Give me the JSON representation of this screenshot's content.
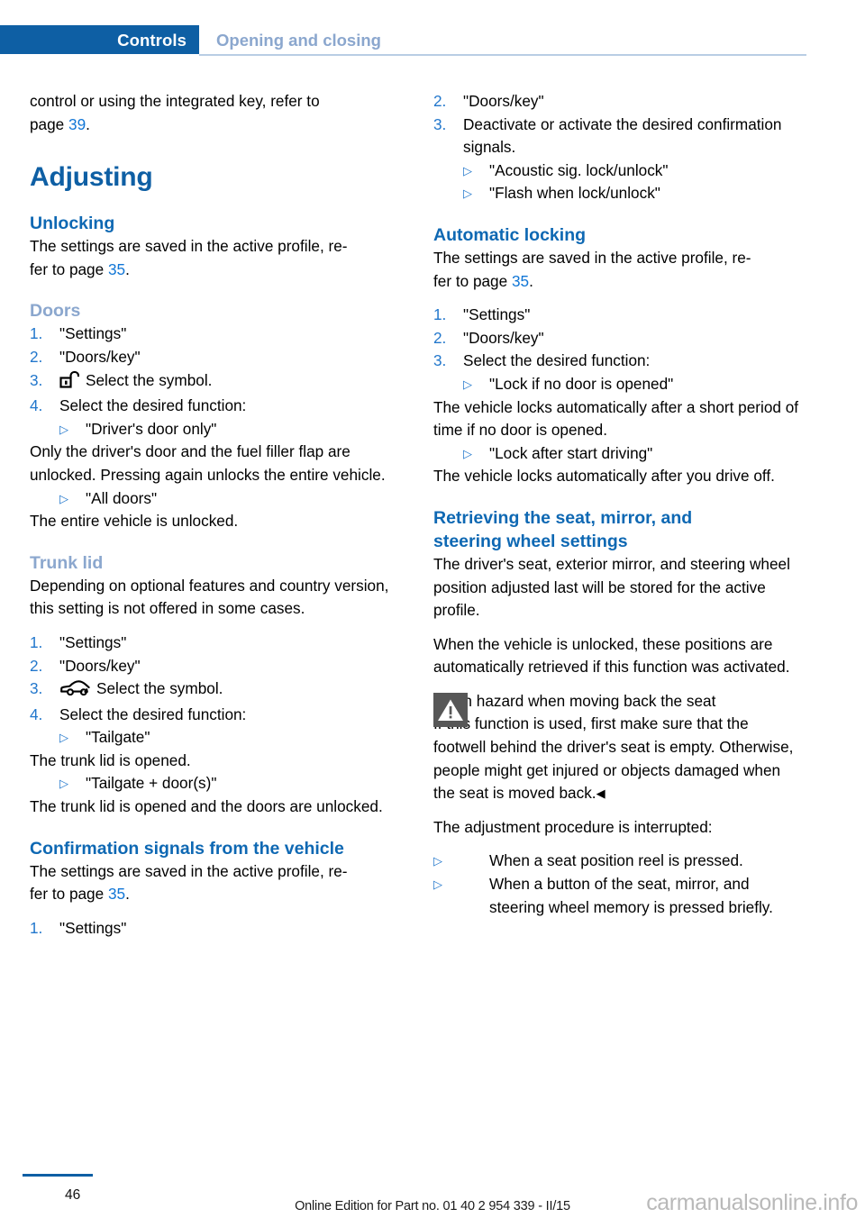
{
  "header": {
    "tab_label": "Controls",
    "section_label": "Opening and closing"
  },
  "left_column": {
    "intro": {
      "line": "control or using the integrated key, refer to",
      "page_prefix": "page ",
      "page_ref": "39",
      "page_suffix": "."
    },
    "title": "Adjusting",
    "unlocking": {
      "heading": "Unlocking",
      "body_a": "The settings are saved in the active profile, re-",
      "body_b": "fer to page ",
      "page_ref": "35",
      "body_c": "."
    },
    "doors": {
      "subheading": "Doors",
      "steps": [
        {
          "num": "1.",
          "text": "\"Settings\""
        },
        {
          "num": "2.",
          "text": "\"Doors/key\""
        },
        {
          "num": "3.",
          "icon": "unlocked-padlock-icon",
          "text": "Select the symbol."
        },
        {
          "num": "4.",
          "text": "Select the desired function:"
        }
      ],
      "options": [
        {
          "label": "\"Driver's door only\"",
          "description": "Only the driver's door and the fuel filler flap are unlocked. Pressing again unlocks the entire vehicle."
        },
        {
          "label": "\"All doors\"",
          "description": "The entire vehicle is unlocked."
        }
      ]
    },
    "trunk_lid": {
      "subheading": "Trunk lid",
      "intro": "Depending on optional features and country version, this setting is not offered in some cases.",
      "steps": [
        {
          "num": "1.",
          "text": "\"Settings\""
        },
        {
          "num": "2.",
          "text": "\"Doors/key\""
        },
        {
          "num": "3.",
          "icon": "car-trunk-open-icon",
          "text": "Select the symbol."
        },
        {
          "num": "4.",
          "text": "Select the desired function:"
        }
      ],
      "options": [
        {
          "label": "\"Tailgate\"",
          "description": "The trunk lid is opened."
        },
        {
          "label": "\"Tailgate + door(s)\"",
          "description": "The trunk lid is opened and the doors are unlocked."
        }
      ]
    },
    "confirmation": {
      "heading": "Confirmation signals from the vehicle",
      "body_a": "The settings are saved in the active profile, re-",
      "body_b": "fer to page ",
      "page_ref": "35",
      "body_c": ".",
      "step1": {
        "num": "1.",
        "text": "\"Settings\""
      }
    }
  },
  "right_column": {
    "confirmation_continued": {
      "step2": {
        "num": "2.",
        "text": "\"Doors/key\""
      },
      "step3": {
        "num": "3.",
        "text": "Deactivate or activate the desired confirmation signals."
      },
      "options": [
        "\"Acoustic sig. lock/unlock\"",
        "\"Flash when lock/unlock\""
      ]
    },
    "automatic_locking": {
      "heading": "Automatic locking",
      "body_a": "The settings are saved in the active profile, re-",
      "body_b": "fer to page ",
      "page_ref": "35",
      "body_c": ".",
      "steps": [
        {
          "num": "1.",
          "text": "\"Settings\""
        },
        {
          "num": "2.",
          "text": "\"Doors/key\""
        },
        {
          "num": "3.",
          "text": "Select the desired function:"
        }
      ],
      "options": [
        {
          "label": "\"Lock if no door is opened\"",
          "description": "The vehicle locks automatically after a short period of time if no door is opened."
        },
        {
          "label": "\"Lock after start driving\"",
          "description": "The vehicle locks automatically after you drive off."
        }
      ]
    },
    "retrieving": {
      "heading_line1": "Retrieving the seat, mirror, and",
      "heading_line2": "steering wheel settings",
      "para1": "The driver's seat, exterior mirror, and steering wheel position adjusted last will be stored for the active profile.",
      "para2": "When the vehicle is unlocked, these positions are automatically retrieved if this function was activated.",
      "warning": {
        "icon": "warning-triangle-icon",
        "title": "Pinch hazard when moving back the seat",
        "text": "If this function is used, first make sure that the footwell behind the driver's seat is empty. Otherwise, people might get injured or objects damaged when the seat is moved back.",
        "end_mark": "◀"
      },
      "para3": "The adjustment procedure is interrupted:",
      "bullets": [
        "When a seat position reel is pressed.",
        "When a button of the seat, mirror, and steering wheel memory is pressed briefly."
      ]
    }
  },
  "footer": {
    "page_number": "46",
    "edition_text": "Online Edition for Part no. 01 40 2 954 339 - II/15",
    "watermark": "carmanualsonline.info"
  },
  "colors": {
    "brand_blue": "#0e5fa4",
    "heading_blue": "#0e68b3",
    "subhead_blue": "#8ba7ce",
    "link_blue": "#1176d6",
    "rule_blue": "#b9cde4",
    "warning_gray": "#575757"
  }
}
